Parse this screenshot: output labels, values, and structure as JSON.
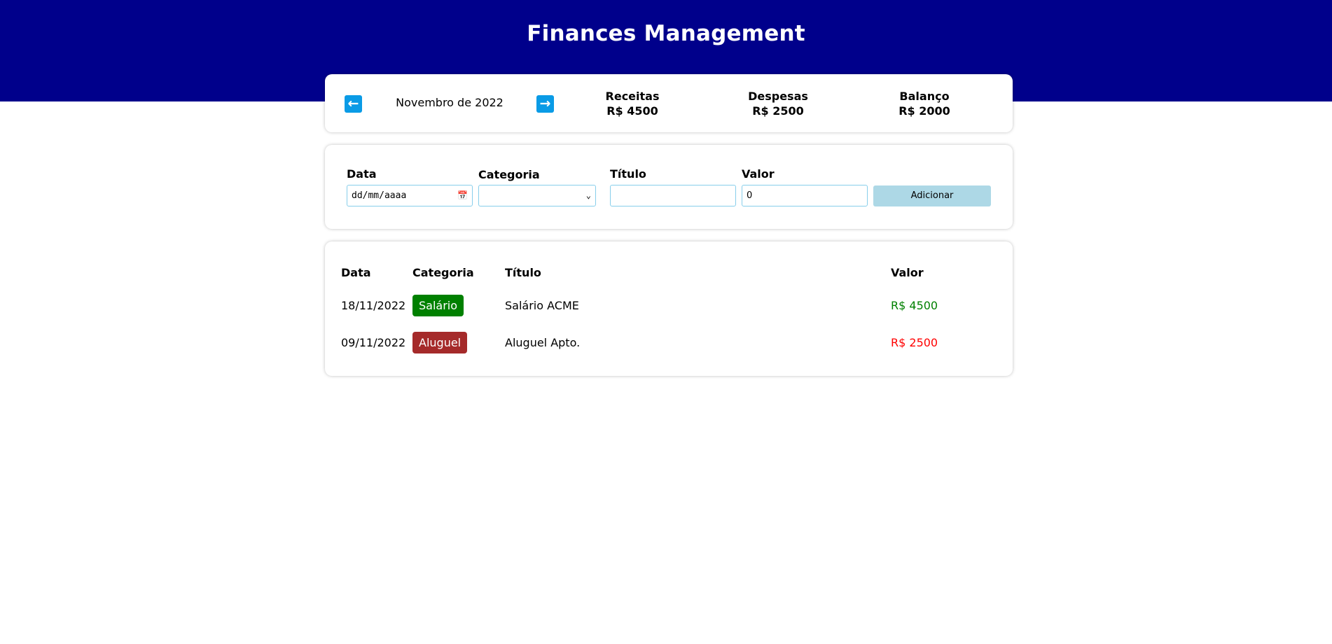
{
  "header": {
    "title": "Finances Management",
    "background": "#00008b"
  },
  "info": {
    "prev_arrow": "←",
    "next_arrow": "→",
    "month": "Novembro de 2022",
    "receitas": {
      "label": "Receitas",
      "value": "R$ 4500"
    },
    "despesas": {
      "label": "Despesas",
      "value": "R$ 2500"
    },
    "balanco": {
      "label": "Balanço",
      "value": "R$ 2000"
    }
  },
  "form": {
    "data_label": "Data",
    "data_placeholder": "dd/mm/aaaa",
    "categoria_label": "Categoria",
    "titulo_label": "Título",
    "valor_label": "Valor",
    "valor_value": "0",
    "add_label": "Adicionar"
  },
  "table": {
    "headers": {
      "data": "Data",
      "categoria": "Categoria",
      "titulo": "Título",
      "valor": "Valor"
    },
    "rows": [
      {
        "data": "18/11/2022",
        "categoria": "Salário",
        "categoria_color": "#008000",
        "titulo": "Salário ACME",
        "valor": "R$ 4500",
        "valor_color": "#008000"
      },
      {
        "data": "09/11/2022",
        "categoria": "Aluguel",
        "categoria_color": "#a52a2a",
        "titulo": "Aluguel Apto.",
        "valor": "R$ 2500",
        "valor_color": "#ff0000"
      }
    ]
  }
}
